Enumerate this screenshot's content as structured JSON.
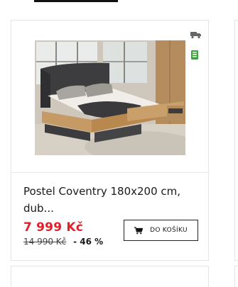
{
  "product": {
    "title": "Postel Coventry 180x200 cm, dub...",
    "price_current": "7 999 Kč",
    "price_old": "14 990 Kč",
    "discount": "- 46 %",
    "cart_button_label": "DO KOŠÍKU",
    "image_alt": "bed"
  },
  "colors": {
    "price_accent": "#e0202a",
    "stock_green": "#3aa63a",
    "border": "#e4e4e4"
  },
  "icons": {
    "delivery": "truck-icon",
    "stock": "stock-icon",
    "cart": "cart-icon"
  }
}
